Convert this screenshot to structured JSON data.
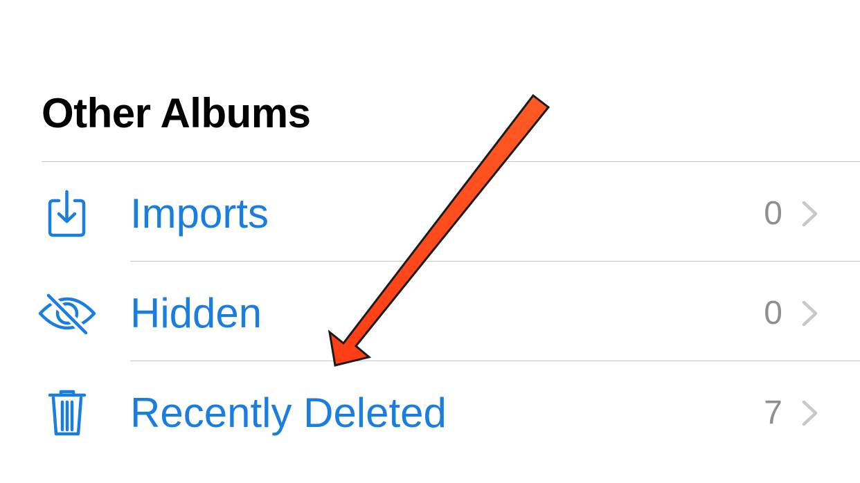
{
  "section": {
    "title": "Other Albums"
  },
  "albums": [
    {
      "label": "Imports",
      "count": "0",
      "icon": "import-icon"
    },
    {
      "label": "Hidden",
      "count": "0",
      "icon": "eye-slash-icon"
    },
    {
      "label": "Recently Deleted",
      "count": "7",
      "icon": "trash-icon"
    }
  ],
  "colors": {
    "accent": "#1a7de0",
    "count": "#8e8e93",
    "chevron": "#c7c7cc",
    "divider": "#c8c7cc",
    "annotation_arrow": "#ff4a1c"
  }
}
